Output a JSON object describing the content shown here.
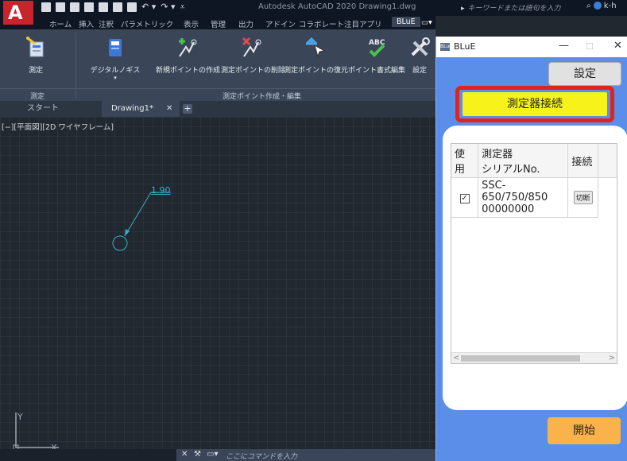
{
  "app": {
    "logo_text": "A",
    "logo_sub": ".",
    "window_title": "Autodesk AutoCAD 2020   Drawing1.dwg",
    "search_placeholder": "キーワードまたは語句を入力",
    "user": "k-h"
  },
  "menu": {
    "tabs": [
      "ホーム",
      "挿入",
      "注釈",
      "パラメトリック",
      "表示",
      "管理",
      "出力",
      "アドイン",
      "コラボレート",
      "注目アプリ",
      "BLuE"
    ],
    "active": "BLuE"
  },
  "ribbon": {
    "buttons": [
      {
        "label": "測定",
        "icon": "measure-icon"
      },
      {
        "label": "デジタルノギス",
        "icon": "digital-caliper-icon"
      },
      {
        "label": "新規ポイントの作成",
        "icon": "new-point-icon"
      },
      {
        "label": "測定ポイントの削除",
        "icon": "delete-point-icon"
      },
      {
        "label": "測定ポイントの復元",
        "icon": "restore-point-icon"
      },
      {
        "label": "ポイント書式編集",
        "icon": "point-format-icon"
      },
      {
        "label": "設定",
        "icon": "settings-tools-icon"
      }
    ],
    "panel_measure": "測定",
    "panel_points": "測定ポイント作成・編集"
  },
  "filetabs": {
    "start": "スタート",
    "drawing": "Drawing1*",
    "close": "✕",
    "new": "+"
  },
  "canvas": {
    "viewport_label": "[−][平面図][2D ワイヤフレーム]",
    "dimension_value": "1.90",
    "ucs_x": "X",
    "ucs_y": "Y"
  },
  "cmdline": {
    "close": "✕",
    "wrench": "🔧",
    "placeholder": "ここにコマンドを入力"
  },
  "blue": {
    "window_icon": "BLuE",
    "title": "BLuE",
    "minimize": "—",
    "maximize": "☐",
    "close": "✕",
    "settings_label": "設定",
    "connect_label": "測定器接続",
    "columns": {
      "use": "使用",
      "serial": "測定器\nシリアルNo.",
      "serial_line1": "測定器",
      "serial_line2": "シリアルNo.",
      "connection": "接続"
    },
    "rows": [
      {
        "checked": "✓",
        "serial_line1": "SSC-650/750/850",
        "serial_line2": "00000000",
        "button": "切断"
      }
    ],
    "scroll_left": "<",
    "scroll_right": ">",
    "start_label": "開始"
  },
  "colors": {
    "accent_yellow": "#f7f31a",
    "alert_red": "#e0231c",
    "start_orange": "#f9b34a",
    "dialog_blue": "#5a8ee8",
    "dimension_cyan": "#38b0c8"
  }
}
